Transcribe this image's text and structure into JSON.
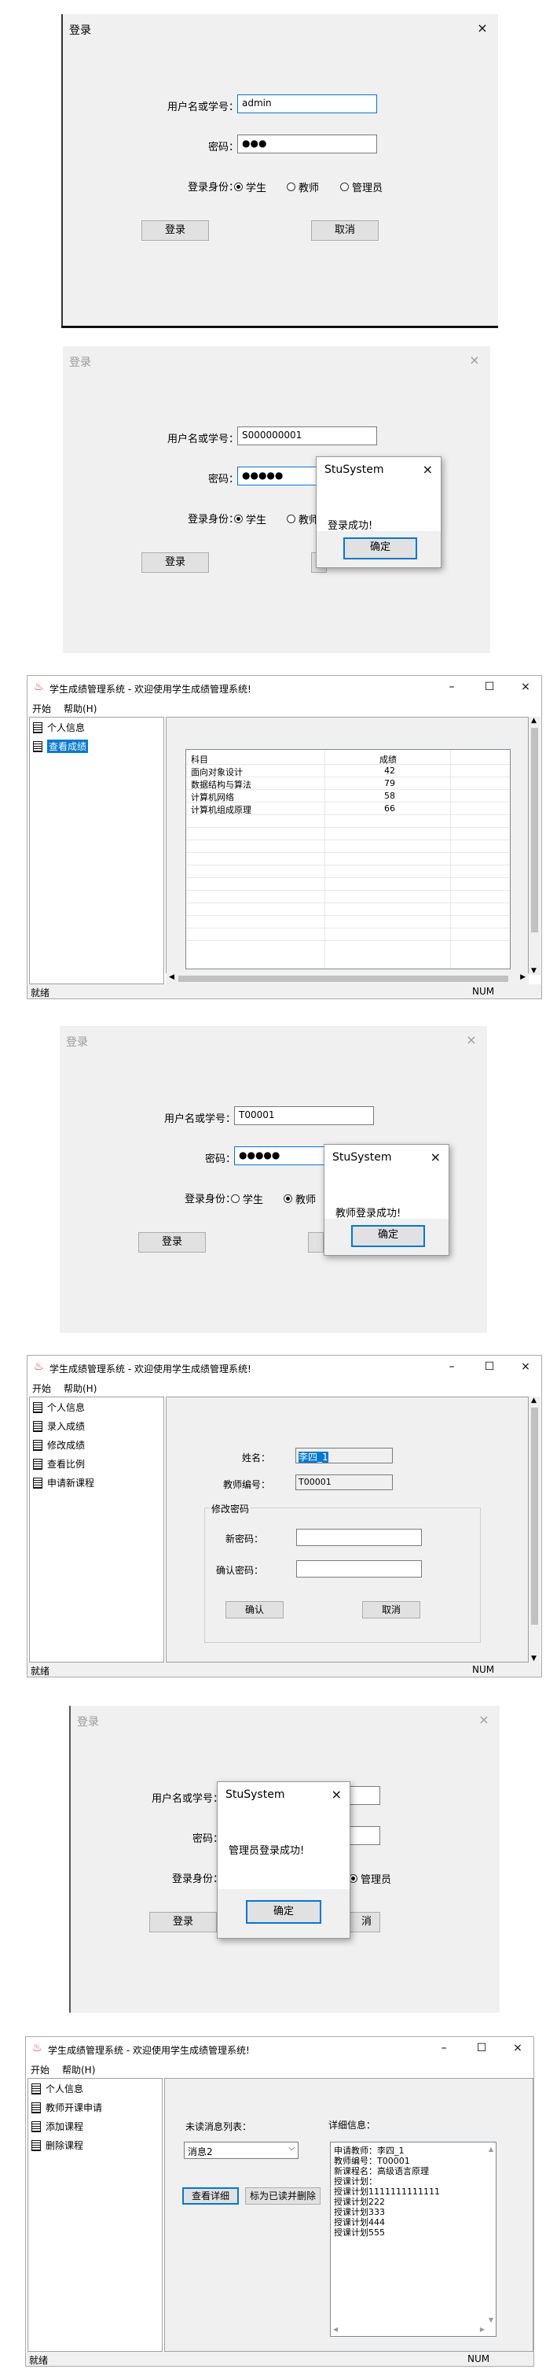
{
  "login": {
    "title": "登录",
    "close": "×",
    "user_label": "用户名或学号：",
    "pwd_label": "密码：",
    "role_label": "登录身份：",
    "role_student": "学生",
    "role_teacher": "教师",
    "role_admin": "管理员",
    "login_btn": "登录",
    "cancel_btn": "取消"
  },
  "panel1": {
    "user_value": "admin",
    "pwd_value": "●●●"
  },
  "panel2": {
    "user_value": "S000000001",
    "pwd_value": "●●●●●",
    "role_teacher_partial": "教师",
    "dialog": {
      "title": "StuSystem",
      "close": "×",
      "message": "登录成功!",
      "ok": "确定"
    }
  },
  "app": {
    "title": "学生成绩管理系统 - 欢迎使用学生成绩管理系统!",
    "min": "–",
    "max": "☐",
    "close": "×",
    "menu_start": "开始",
    "menu_help": "帮助(H)",
    "status_ready": "就绪",
    "status_num": "NUM"
  },
  "panel3": {
    "tree": [
      "个人信息",
      "查看成绩"
    ],
    "grid_headers": [
      "科目",
      "成绩"
    ],
    "grid_rows": [
      [
        "面向对象设计",
        "42"
      ],
      [
        "数据结构与算法",
        "79"
      ],
      [
        "计算机网络",
        "58"
      ],
      [
        "计算机组成原理",
        "66"
      ]
    ]
  },
  "panel4": {
    "user_value": "T00001",
    "pwd_value": "●●●●●",
    "dialog": {
      "title": "StuSystem",
      "close": "×",
      "message": "教师登录成功!",
      "ok": "确定"
    }
  },
  "panel5": {
    "tree": [
      "个人信息",
      "录入成绩",
      "修改成绩",
      "查看比例",
      "申请新课程"
    ],
    "name_label": "姓名：",
    "name_value": "李四_1",
    "id_label": "教师编号：",
    "id_value": "T00001",
    "group_title": "修改密码",
    "newpwd_label": "新密码：",
    "confirm_label": "确认密码：",
    "ok_btn": "确认",
    "cancel_btn": "取消"
  },
  "panel6": {
    "dialog": {
      "title": "StuSystem",
      "close": "×",
      "message": "管理员登录成功!",
      "ok": "确定"
    },
    "partial_cancel": "消"
  },
  "panel7": {
    "menu_help": "帮助(H)",
    "tree": [
      "个人信息",
      "教师开课申请",
      "添加课程",
      "删除课程"
    ],
    "unread_label": "未读消息列表：",
    "detail_label": "详细信息：",
    "combo_value": "消息2",
    "view_btn": "查看详细",
    "mark_btn": "标为已读并删除",
    "detail_lines": [
      "申请教师：李四_1",
      "教师编号：T00001",
      "新课程名：高级语言原理",
      "授课计划：",
      "授课计划1111111111111",
      "授课计划222",
      "授课计划333",
      "授课计划444",
      "授课计划555"
    ]
  }
}
